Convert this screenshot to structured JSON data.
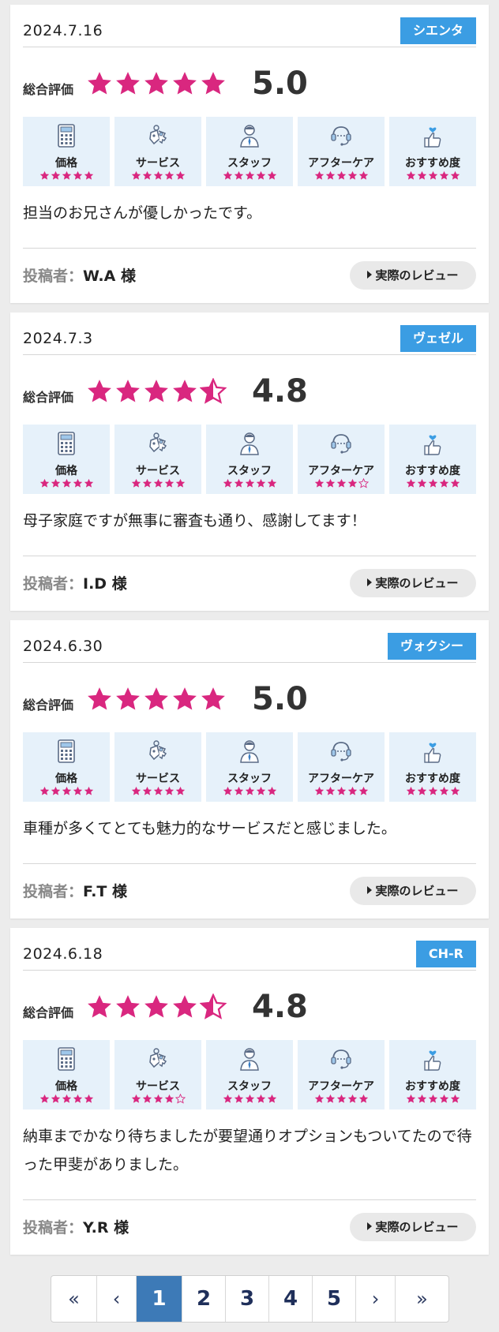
{
  "colors": {
    "accent_pink": "#d9277f",
    "model_badge": "#3b9de3",
    "category_bg": "#e6f1fa",
    "pager_active": "#3d7ab7"
  },
  "labels": {
    "overall": "総合評価",
    "poster": "投稿者：",
    "review_button": "実際のレビュー",
    "categories": [
      "価格",
      "サービス",
      "スタッフ",
      "アフターケア",
      "おすすめ度"
    ],
    "category_icons": [
      "calculator-icon",
      "keys-icon",
      "staff-icon",
      "headset-icon",
      "thumbs-up-heart-icon"
    ]
  },
  "reviews": [
    {
      "date": "2024.7.16",
      "model": "シエンタ",
      "overall_rating": 5.0,
      "score_text": "5.0",
      "category_ratings": [
        5,
        5,
        5,
        5,
        5
      ],
      "comment": "担当のお兄さんが優しかったです。",
      "poster": "W.A 様"
    },
    {
      "date": "2024.7.3",
      "model": "ヴェゼル",
      "overall_rating": 4.5,
      "score_text": "4.8",
      "category_ratings": [
        5,
        5,
        5,
        4,
        5
      ],
      "comment": "母子家庭ですが無事に審査も通り、感謝してます！",
      "poster": "I.D 様"
    },
    {
      "date": "2024.6.30",
      "model": "ヴォクシー",
      "overall_rating": 5.0,
      "score_text": "5.0",
      "category_ratings": [
        5,
        5,
        5,
        5,
        5
      ],
      "comment": "車種が多くてとても魅力的なサービスだと感じました。",
      "poster": "F.T 様"
    },
    {
      "date": "2024.6.18",
      "model": "CH-R",
      "overall_rating": 4.5,
      "score_text": "4.8",
      "category_ratings": [
        5,
        4,
        5,
        5,
        5
      ],
      "comment": "納車までかなり待ちましたが要望通りオプションもついてたので待った甲斐がありました。",
      "poster": "Y.R 様"
    }
  ],
  "pagination": {
    "first": "«",
    "prev": "‹",
    "pages": [
      "1",
      "2",
      "3",
      "4",
      "5"
    ],
    "current": "1",
    "next": "›",
    "last": "»"
  }
}
